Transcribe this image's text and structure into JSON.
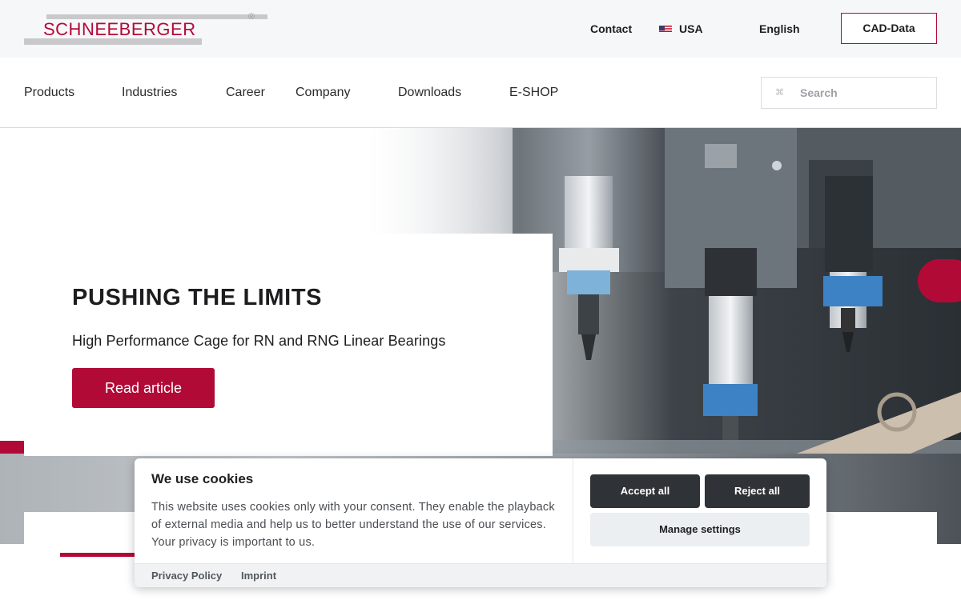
{
  "brand": {
    "logo_text": "SCHNEEBERGER",
    "registered_mark": "®",
    "accent_color": "#b20a37"
  },
  "topbar": {
    "contact": "Contact",
    "country": "USA",
    "language": "English",
    "cad_button": "CAD-Data"
  },
  "nav": {
    "items": [
      {
        "label": "Products"
      },
      {
        "label": "Industries"
      },
      {
        "label": "Career"
      },
      {
        "label": "Company"
      },
      {
        "label": "Downloads"
      },
      {
        "label": "E-SHOP"
      }
    ],
    "search_placeholder": "Search"
  },
  "hero": {
    "title": "PUSHING THE LIMITS",
    "subtitle": "High Performance Cage for RN and RNG Linear Bearings",
    "cta": "Read article"
  },
  "cookie": {
    "title": "We use cookies",
    "text": "This website uses cookies only with your consent. They enable the playback of external media and help us to better understand the use of our services. Your privacy is important to us.",
    "accept_all": "Accept all",
    "reject_all": "Reject all",
    "manage_settings": "Manage settings",
    "privacy_policy": "Privacy Policy",
    "imprint": "Imprint"
  }
}
